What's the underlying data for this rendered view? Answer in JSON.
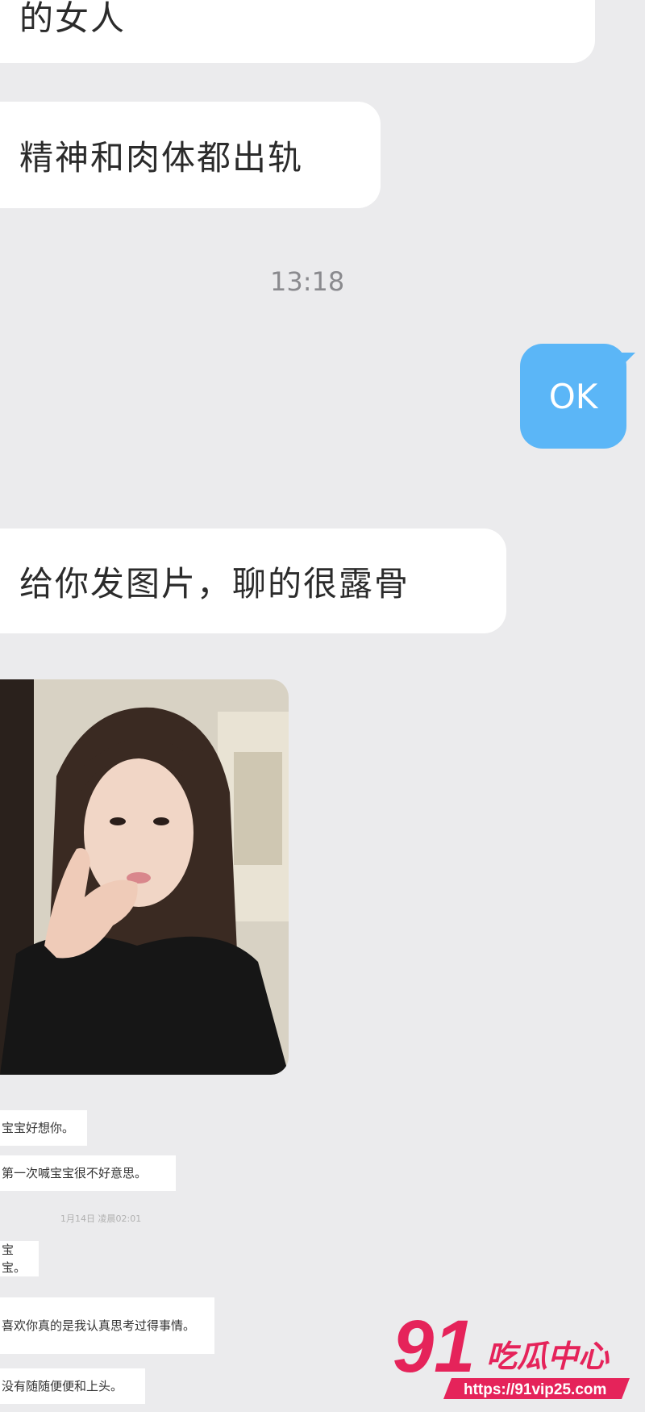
{
  "messages": {
    "first": "的女人",
    "second": "精神和肉体都出轨",
    "time": "13:18",
    "reply": "OK",
    "third": "给你发图片，聊的很露骨"
  },
  "screenshot": {
    "lines": [
      "宝宝好想你。",
      "第一次喊宝宝很不好意思。",
      "1月14日 凌晨02:01",
      "宝宝。",
      "喜欢你真的是我认真思考过得事情。",
      "没有随随便便和上头。"
    ]
  },
  "watermark": {
    "number": "91",
    "title": "吃瓜中心",
    "url": "https://91vip25.com"
  },
  "colors": {
    "background": "#ebebed",
    "received_bubble": "#ffffff",
    "sent_bubble": "#5bb6f7",
    "watermark": "#e5235a"
  }
}
